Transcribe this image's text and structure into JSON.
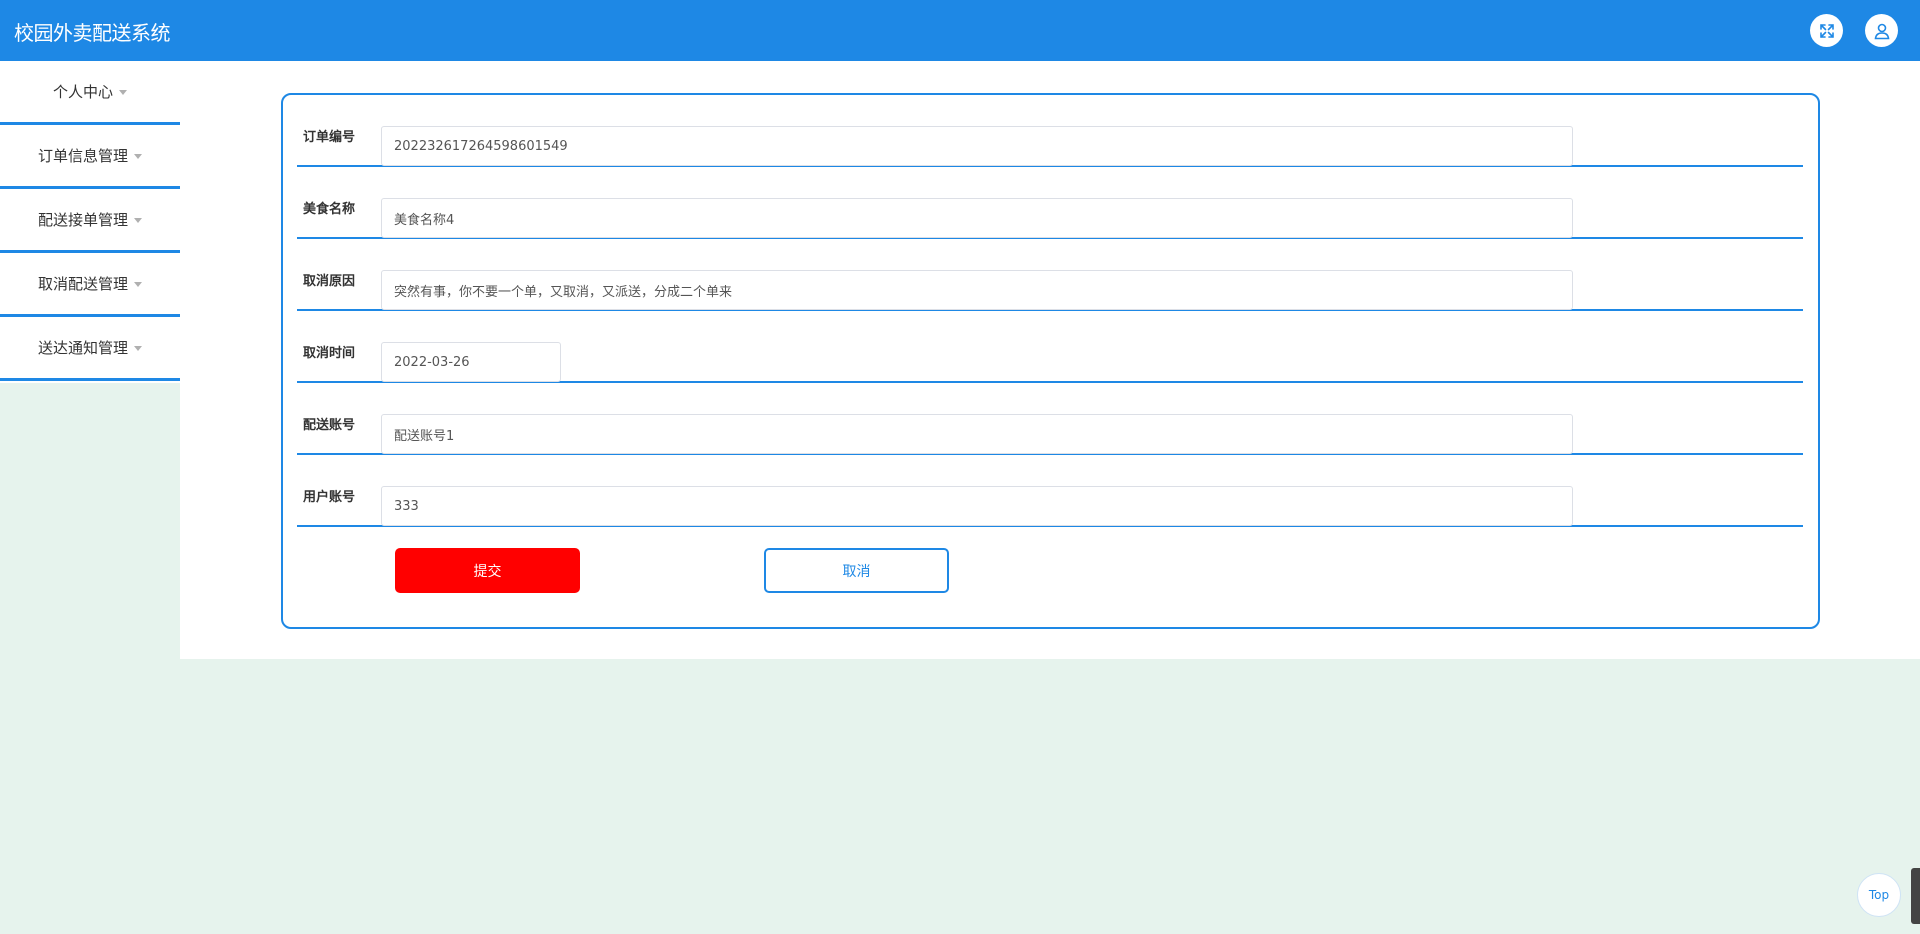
{
  "header": {
    "title": "校园外卖配送系统",
    "fullscreen_icon": "expand-icon",
    "user_icon": "user-icon"
  },
  "sidebar": {
    "items": [
      {
        "label": "个人中心"
      },
      {
        "label": "订单信息管理"
      },
      {
        "label": "配送接单管理"
      },
      {
        "label": "取消配送管理"
      },
      {
        "label": "送达通知管理"
      }
    ]
  },
  "form": {
    "fields": [
      {
        "label": "订单编号",
        "value": "202232617264598601549"
      },
      {
        "label": "美食名称",
        "value": "美食名称4"
      },
      {
        "label": "取消原因",
        "value": "突然有事，你不要一个单，又取消，又派送，分成二个单来"
      },
      {
        "label": "取消时间",
        "value": "2022-03-26"
      },
      {
        "label": "配送账号",
        "value": "配送账号1"
      },
      {
        "label": "用户账号",
        "value": "333"
      }
    ],
    "submit_label": "提交",
    "cancel_label": "取消"
  },
  "back_to_top_label": "Top",
  "colors": {
    "primary": "#1e88e5",
    "submit": "#ff0000",
    "background": "#e6f3ed"
  }
}
